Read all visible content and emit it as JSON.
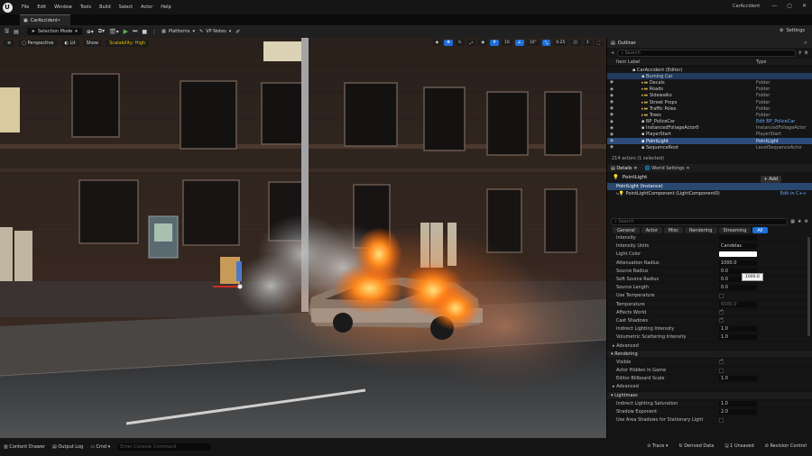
{
  "menubar": {
    "menus": [
      "File",
      "Edit",
      "Window",
      "Tools",
      "Build",
      "Select",
      "Actor",
      "Help"
    ],
    "project": "CarAccident",
    "controls": [
      "—",
      "▢",
      "✕"
    ]
  },
  "tabs": {
    "level": "CarAccident•"
  },
  "toolbar": {
    "mode": "Selection Mode",
    "platforms": "Platforms",
    "vp_notes": "VP Notes",
    "settings": "Settings"
  },
  "viewport": {
    "perspective": "Perspective",
    "lit": "Lit",
    "show": "Show",
    "scalability": "Scalability: High",
    "right_items": [
      "10",
      "10°",
      "0.25",
      "1"
    ]
  },
  "outliner": {
    "title": "Outliner",
    "search_placeholder": "Search",
    "col_label": "Item Label",
    "col_type": "Type",
    "rows": [
      {
        "label": "CarAccident (Editor)",
        "type": "",
        "indent": 0,
        "style": ""
      },
      {
        "label": "Burning Car",
        "type": "",
        "indent": 1,
        "style": "hl"
      },
      {
        "label": "Decals",
        "type": "Folder",
        "indent": 1,
        "style": "folder"
      },
      {
        "label": "Roads",
        "type": "Folder",
        "indent": 1,
        "style": "folder"
      },
      {
        "label": "Sidewalks",
        "type": "Folder",
        "indent": 1,
        "style": "folder"
      },
      {
        "label": "Street Props",
        "type": "Folder",
        "indent": 1,
        "style": "folder"
      },
      {
        "label": "Traffic Poles",
        "type": "Folder",
        "indent": 1,
        "style": "folder"
      },
      {
        "label": "Trees",
        "type": "Folder",
        "indent": 1,
        "style": "folder"
      },
      {
        "label": "BP_PoliceCar",
        "type": "Edit BP_PoliceCar",
        "indent": 1,
        "style": ""
      },
      {
        "label": "InstancedFoliageActor0",
        "type": "InstancedFoliageActor",
        "indent": 1,
        "style": ""
      },
      {
        "label": "PlayerStart",
        "type": "PlayerStart",
        "indent": 1,
        "style": ""
      },
      {
        "label": "PointLight",
        "type": "PointLight",
        "indent": 1,
        "style": "sel"
      },
      {
        "label": "SequenceRoot",
        "type": "LevelSequenceActor",
        "indent": 1,
        "style": ""
      }
    ],
    "count": "214 actors (1 selected)"
  },
  "details": {
    "tab_details": "Details",
    "tab_world": "World Settings",
    "actor": "PointLight",
    "add": "+ Add",
    "instance": "PointLight (Instance)",
    "component": "PointLightComponent (LightComponent0)",
    "edit_cpp": "Edit in C++",
    "search_placeholder": "Search",
    "filters": [
      "General",
      "Actor",
      "Misc",
      "Rendering",
      "Streaming",
      "All"
    ],
    "props": [
      {
        "label": "Intensity",
        "value": "",
        "kind": "partial"
      },
      {
        "label": "Intensity Units",
        "value": "Candelas",
        "kind": "drop"
      },
      {
        "label": "Light Color",
        "value": "",
        "kind": "color"
      },
      {
        "label": "Attenuation Radius",
        "value": "1000.0",
        "kind": "num"
      },
      {
        "label": "Source Radius",
        "value": "0.0",
        "kind": "num"
      },
      {
        "label": "Soft Source Radius",
        "value": "0.0",
        "kind": "num"
      },
      {
        "label": "Source Length",
        "value": "0.0",
        "kind": "num"
      },
      {
        "label": "Use Temperature",
        "value": "",
        "kind": "chk"
      },
      {
        "label": "Temperature",
        "value": "6500.0",
        "kind": "grey"
      },
      {
        "label": "Affects World",
        "value": "",
        "kind": "chkon"
      },
      {
        "label": "Cast Shadows",
        "value": "",
        "kind": "chkon"
      },
      {
        "label": "Indirect Lighting Intensity",
        "value": "1.0",
        "kind": "num"
      },
      {
        "label": "Volumetric Scattering Intensity",
        "value": "1.0",
        "kind": "num"
      }
    ],
    "sec_advanced1": "Advanced",
    "sec_rendering": "Rendering",
    "rendering_props": [
      {
        "label": "Visible",
        "value": "",
        "kind": "chkon"
      },
      {
        "label": "Actor Hidden In Game",
        "value": "",
        "kind": "chk"
      },
      {
        "label": "Editor Billboard Scale",
        "value": "1.0",
        "kind": "num"
      }
    ],
    "sec_advanced2": "Advanced",
    "sec_lightmass": "Lightmass",
    "lightmass_props": [
      {
        "label": "Indirect Lighting Saturation",
        "value": "1.0",
        "kind": "num"
      },
      {
        "label": "Shadow Exponent",
        "value": "2.0",
        "kind": "num"
      },
      {
        "label": "Use Area Shadows for Stationary Light",
        "value": "",
        "kind": "chk"
      }
    ],
    "tooltip": "1000.0"
  },
  "statusbar": {
    "content_drawer": "Content Drawer",
    "output_log": "Output Log",
    "cmd": "Cmd",
    "console_placeholder": "Enter Console Command",
    "trace": "Trace",
    "derived": "Derived Data",
    "unsaved": "1 Unsaved",
    "revision": "Revision Control"
  }
}
